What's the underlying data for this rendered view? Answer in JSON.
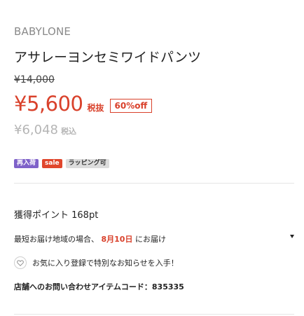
{
  "product": {
    "brand": "BABYLONE",
    "title": "アサレーヨンセミワイドパンツ"
  },
  "pricing": {
    "original_price": "¥14,000",
    "sale_price": "¥5,600",
    "tax_label": "税抜",
    "discount": "60%off",
    "tax_included_price": "¥6,048",
    "tax_included_label": "税込",
    "sale_color": "#d9412b"
  },
  "tags": [
    {
      "label": "再入荷",
      "color": "#7f62c9"
    },
    {
      "label": "sale",
      "color": "#e0462c"
    },
    {
      "label": "ラッピング可",
      "color": "#dcdcdc"
    }
  ],
  "points": {
    "text": "獲得ポイント 168pt"
  },
  "delivery": {
    "prefix": "最短お届け地域の場合、",
    "date": "8月10日",
    "suffix": "にお届け",
    "toggle_icon": "chevron-down-icon"
  },
  "favorite": {
    "icon": "heart-icon",
    "text": "お気に入り登録で特別なお知らせを入手！"
  },
  "inquiry": {
    "text": "店舗へのお問い合わせアイテムコード：835335"
  }
}
